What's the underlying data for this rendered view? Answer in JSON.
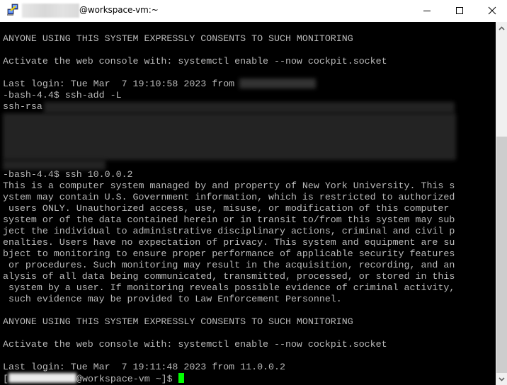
{
  "window": {
    "title_suffix": "@workspace-vm:~",
    "title_prefix_redacted": true,
    "app_icon": "putty-icon",
    "controls": {
      "minimize": "minimize-icon",
      "maximize": "maximize-icon",
      "close": "close-icon"
    }
  },
  "terminal": {
    "colors": {
      "background": "#000000",
      "foreground": "#bbbbbb",
      "cursor": "#00ff00"
    },
    "lines": [
      "ANYONE USING THIS SYSTEM EXPRESSLY CONSENTS TO SUCH MONITORING",
      "",
      "Activate the web console with: systemctl enable --now cockpit.socket",
      "",
      "Last login: Tue Mar  7 19:10:58 2023 from",
      "-bash-4.4$ ssh-add -L",
      "ssh-rsa",
      "",
      "",
      "",
      "",
      "",
      "-bash-4.4$ ssh 10.0.0.2",
      "This is a computer system managed by and property of New York University. This s",
      "ystem may contain U.S. Government information, which is restricted to authorized",
      " users ONLY. Unauthorized access, use, misuse, or modification of this computer",
      "system or of the data contained herein or in transit to/from this system may sub",
      "ject the individual to administrative disciplinary actions, criminal and civil p",
      "enalties. Users have no expectation of privacy. This system and equipment are su",
      "bject to monitoring to ensure proper performance of applicable security features",
      " or procedures. Such monitoring may result in the acquisition, recording, and an",
      "alysis of all data being communicated, transmitted, processed, or stored in this",
      " system by a user. If monitoring reveals possible evidence of criminal activity,",
      " such evidence may be provided to Law Enforcement Personnel.",
      "",
      "ANYONE USING THIS SYSTEM EXPRESSLY CONSENTS TO SUCH MONITORING",
      "",
      "Activate the web console with: systemctl enable --now cockpit.socket",
      "",
      "Last login: Tue Mar  7 19:11:48 2023 from 11.0.0.2"
    ],
    "prompt": {
      "open_bracket": "[",
      "user_redacted": true,
      "host_part": "@workspace-vm ~]$ "
    }
  },
  "scrollbar": {
    "up_icon": "chevron-up-icon",
    "down_icon": "chevron-down-icon",
    "position_fraction": 0.45,
    "visible_fraction": 0.7
  }
}
